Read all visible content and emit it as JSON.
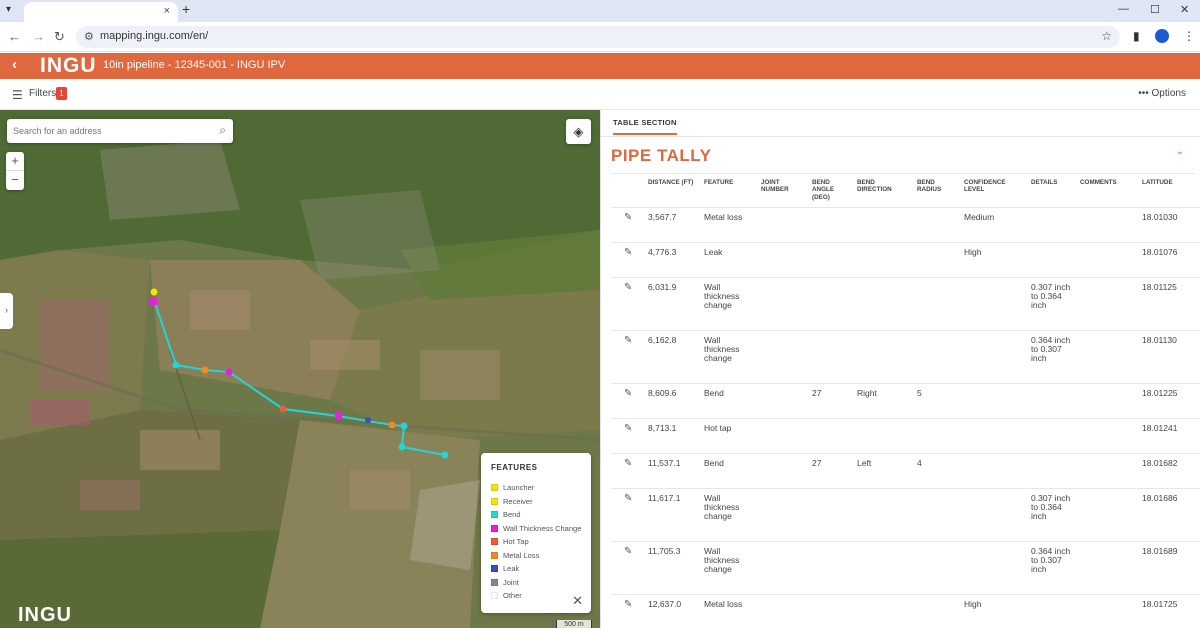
{
  "browser": {
    "tab_close": "×",
    "new_tab": "+",
    "url": "mapping.ingu.com/en/"
  },
  "app": {
    "logo": "INGU",
    "title": "10in pipeline - 12345-001 - INGU IPV",
    "brand_color": "#e0683f"
  },
  "filters": {
    "label": "Filters",
    "count": "1",
    "options_label": "Options"
  },
  "map": {
    "search_placeholder": "Search for an address",
    "zoom_in": "+",
    "zoom_out": "−",
    "logo": "INGU",
    "scale": "500 m",
    "legend": {
      "title": "FEATURES",
      "items": [
        {
          "label": "Launcher",
          "color": "#f4e400"
        },
        {
          "label": "Receiver",
          "color": "#f4e400"
        },
        {
          "label": "Bend",
          "color": "#21d6d6"
        },
        {
          "label": "Wall Thickness Change",
          "color": "#e81ee0"
        },
        {
          "label": "Hot Tap",
          "color": "#ee5a3a"
        },
        {
          "label": "Metal Loss",
          "color": "#f28c1e"
        },
        {
          "label": "Leak",
          "color": "#3b4fb4"
        },
        {
          "label": "Joint",
          "color": "#888888"
        },
        {
          "label": "Other",
          "color": "#ffffff"
        }
      ]
    }
  },
  "panel": {
    "tab": "TABLE SECTION",
    "title": "PIPE TALLY",
    "columns": [
      "",
      "DISTANCE (FT)",
      "FEATURE",
      "JOINT NUMBER",
      "BEND ANGLE (DEG)",
      "BEND DIRECTION",
      "BEND RADIUS",
      "CONFIDENCE LEVEL",
      "DETAILS",
      "COMMENTS",
      "LATITUDE"
    ],
    "rows": [
      {
        "distance": "3,567.7",
        "feature": "Metal loss",
        "joint": "",
        "angle": "",
        "direction": "",
        "radius": "",
        "confidence": "Medium",
        "details": "",
        "comments": "",
        "latitude": "18.01030"
      },
      {
        "distance": "4,776.3",
        "feature": "Leak",
        "joint": "",
        "angle": "",
        "direction": "",
        "radius": "",
        "confidence": "High",
        "details": "",
        "comments": "",
        "latitude": "18.01076"
      },
      {
        "distance": "6,031.9",
        "feature": "Wall thickness change",
        "joint": "",
        "angle": "",
        "direction": "",
        "radius": "",
        "confidence": "",
        "details": "0.307 inch to 0.364 inch",
        "comments": "",
        "latitude": "18.01125"
      },
      {
        "distance": "6,162.8",
        "feature": "Wall thickness change",
        "joint": "",
        "angle": "",
        "direction": "",
        "radius": "",
        "confidence": "",
        "details": "0.364 inch to 0.307 inch",
        "comments": "",
        "latitude": "18.01130"
      },
      {
        "distance": "8,609.6",
        "feature": "Bend",
        "joint": "",
        "angle": "27",
        "direction": "Right",
        "radius": "5",
        "confidence": "",
        "details": "",
        "comments": "",
        "latitude": "18.01225"
      },
      {
        "distance": "8,713.1",
        "feature": "Hot tap",
        "joint": "",
        "angle": "",
        "direction": "",
        "radius": "",
        "confidence": "",
        "details": "",
        "comments": "",
        "latitude": "18.01241"
      },
      {
        "distance": "11,537.1",
        "feature": "Bend",
        "joint": "",
        "angle": "27",
        "direction": "Left",
        "radius": "4",
        "confidence": "",
        "details": "",
        "comments": "",
        "latitude": "18.01682"
      },
      {
        "distance": "11,617.1",
        "feature": "Wall thickness change",
        "joint": "",
        "angle": "",
        "direction": "",
        "radius": "",
        "confidence": "",
        "details": "0.307 inch to 0.364 inch",
        "comments": "",
        "latitude": "18.01686"
      },
      {
        "distance": "11,705.3",
        "feature": "Wall thickness change",
        "joint": "",
        "angle": "",
        "direction": "",
        "radius": "",
        "confidence": "",
        "details": "0.364 inch to 0.307 inch",
        "comments": "",
        "latitude": "18.01689"
      },
      {
        "distance": "12,637.0",
        "feature": "Metal loss",
        "joint": "",
        "angle": "",
        "direction": "",
        "radius": "",
        "confidence": "High",
        "details": "",
        "comments": "",
        "latitude": "18.01725"
      }
    ]
  }
}
